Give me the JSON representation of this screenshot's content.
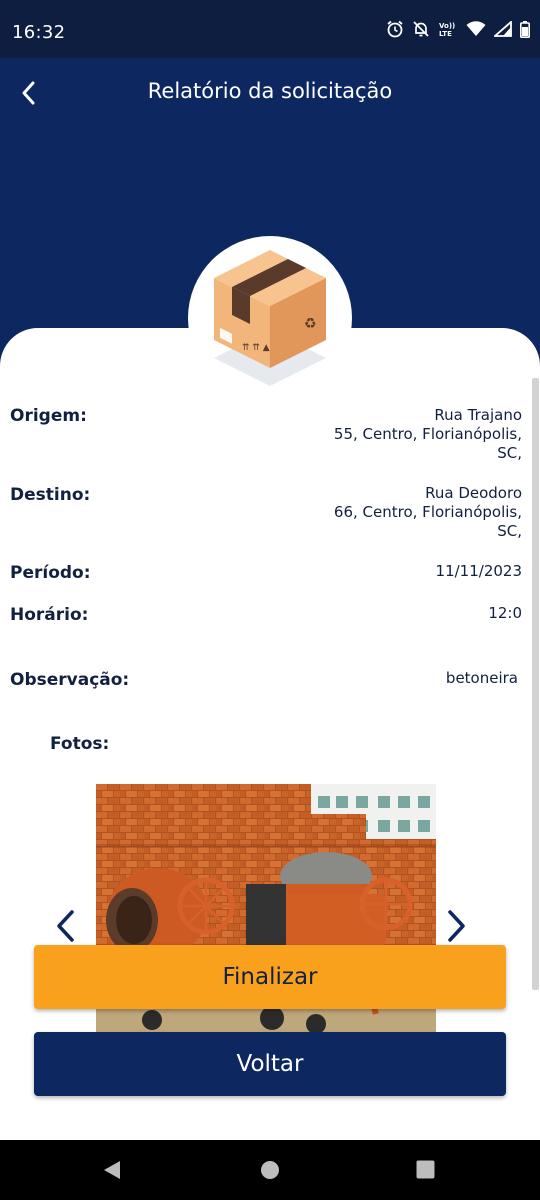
{
  "status_bar": {
    "time": "16:32",
    "icons": [
      "alarm-icon",
      "notifications-off-icon",
      "volte-icon",
      "wifi-icon",
      "signal-icon",
      "battery-icon"
    ],
    "volte_label": "Vo)) LTE"
  },
  "header": {
    "title": "Relatório da solicitação",
    "back_icon": "chevron-left-icon",
    "avatar_icon": "package-box-icon"
  },
  "details": {
    "origem": {
      "label": "Origem:",
      "lines": [
        "Rua Trajano",
        "55, Centro, Florianópolis,",
        "SC,"
      ]
    },
    "destino": {
      "label": "Destino:",
      "lines": [
        "Rua Deodoro",
        "66, Centro, Florianópolis,",
        "SC,"
      ]
    },
    "periodo": {
      "label": "Período:",
      "value": "11/11/2023"
    },
    "horario": {
      "label": "Horário:",
      "value": "12:0"
    },
    "observacao": {
      "label": "Observação:",
      "value": "betoneira"
    },
    "fotos": {
      "label": "Fotos:"
    }
  },
  "carousel": {
    "prev_icon": "chevron-left-icon",
    "next_icon": "chevron-right-icon",
    "photo": "concrete-mixers-photo"
  },
  "buttons": {
    "finalizar": "Finalizar",
    "voltar": "Voltar"
  },
  "nav_bar": {
    "back": "nav-back-icon",
    "home": "nav-home-icon",
    "recents": "nav-recents-icon"
  },
  "colors": {
    "primary": "#0d2760",
    "accent": "#f9a11c",
    "status_bar": "#0e1e40",
    "text": "#12213f"
  }
}
